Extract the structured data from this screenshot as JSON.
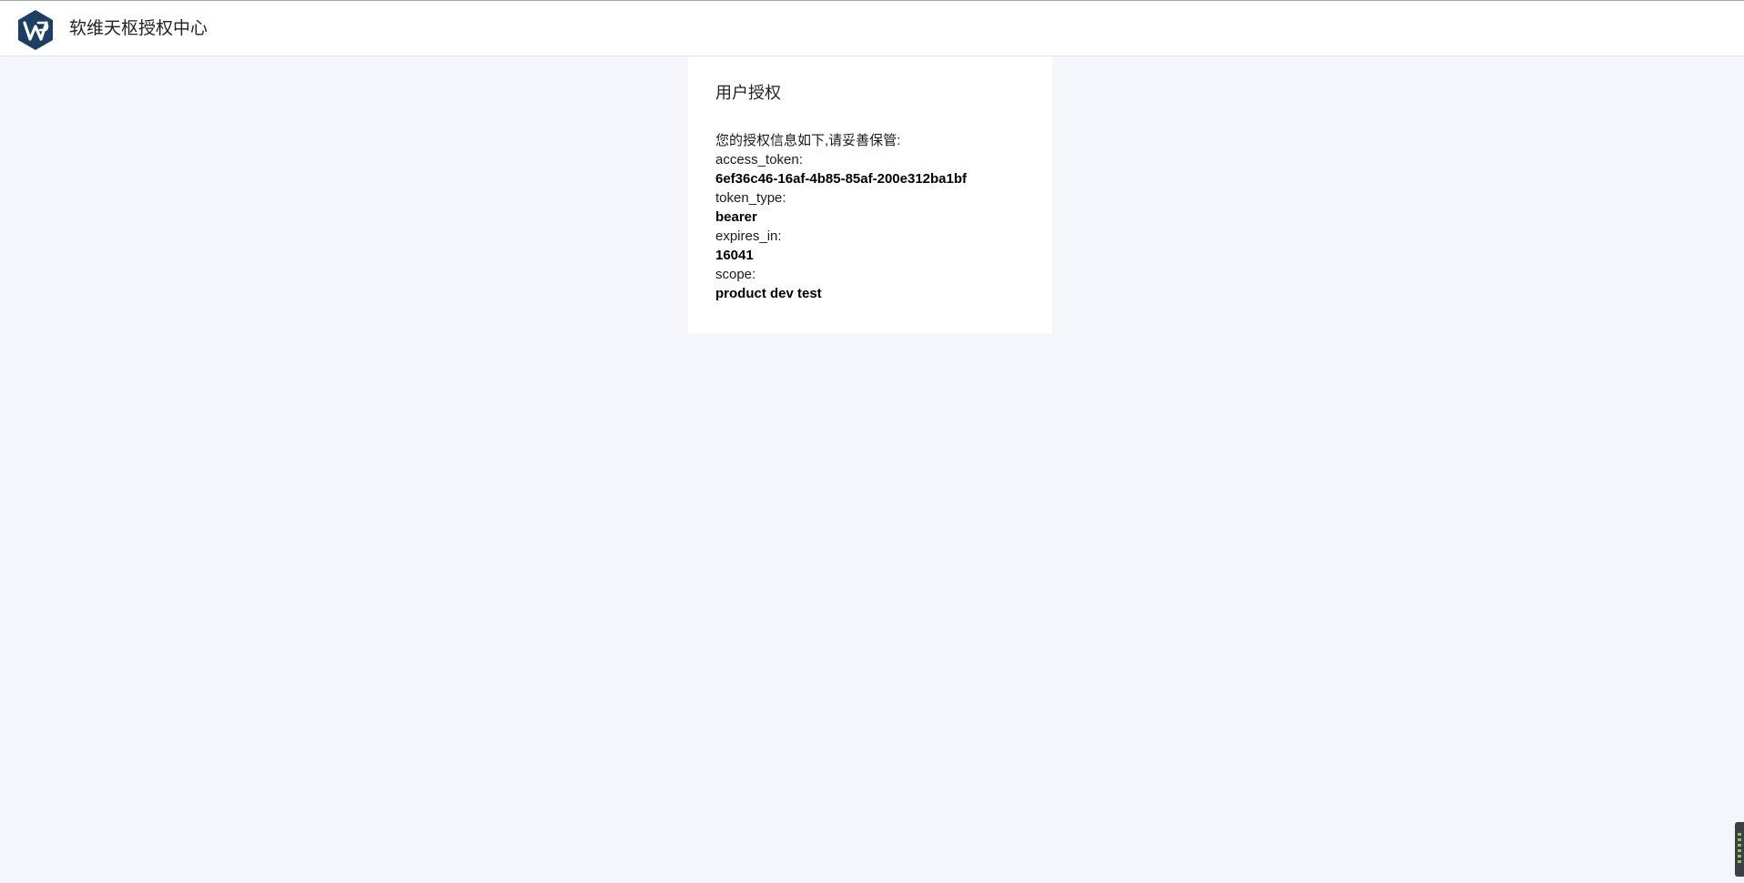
{
  "header": {
    "title": "软维天枢授权中心",
    "logo_icon": "wt-hexagon-logo-icon",
    "logo_color": "#1c3f66"
  },
  "card": {
    "title": "用户授权",
    "intro": "您的授权信息如下,请妥善保管:",
    "fields": [
      {
        "label": "access_token:",
        "value": "6ef36c46-16af-4b85-85af-200e312ba1bf"
      },
      {
        "label": "token_type:",
        "value": "bearer"
      },
      {
        "label": "expires_in:",
        "value": "16041"
      },
      {
        "label": "scope:",
        "value": "product dev test"
      }
    ]
  },
  "colors": {
    "page_background": "#f4f6f9",
    "card_background": "#ffffff"
  }
}
